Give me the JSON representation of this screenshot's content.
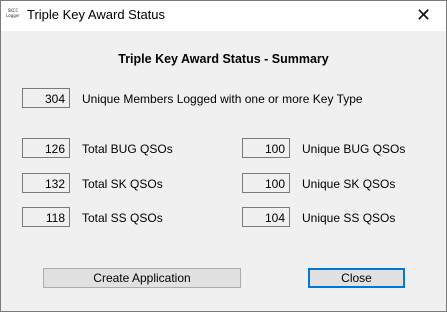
{
  "window": {
    "title": "Triple Key Award Status",
    "app_icon_text": "SKCC Logger",
    "close_glyph": "✕"
  },
  "heading": "Triple Key Award Status - Summary",
  "unique_members": {
    "value": "304",
    "label": "Unique Members Logged with one or more Key Type"
  },
  "left_stats": [
    {
      "value": "126",
      "label": "Total BUG QSOs"
    },
    {
      "value": "132",
      "label": "Total SK QSOs"
    },
    {
      "value": "118",
      "label": "Total SS QSOs"
    }
  ],
  "right_stats": [
    {
      "value": "100",
      "label": "Unique BUG QSOs"
    },
    {
      "value": "100",
      "label": "Unique SK QSOs"
    },
    {
      "value": "104",
      "label": "Unique SS QSOs"
    }
  ],
  "buttons": {
    "create_application": "Create Application",
    "close": "Close"
  }
}
